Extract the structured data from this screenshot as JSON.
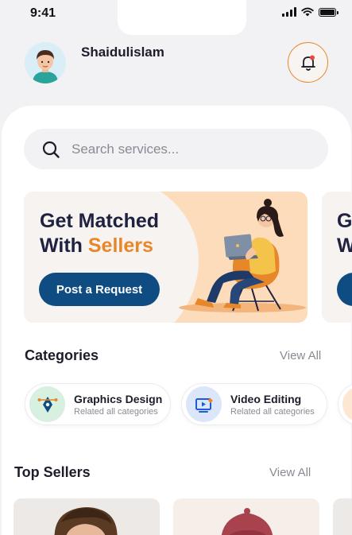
{
  "status_bar": {
    "time": "9:41"
  },
  "header": {
    "user_name": "Shaidulislam"
  },
  "search": {
    "placeholder": "Search services..."
  },
  "banner": {
    "title_line1": "Get Matched",
    "title_line2_prefix": "With ",
    "title_line2_accent": "Sellers",
    "button_label": "Post a Request",
    "next_title_line1": "G",
    "next_title_line2": "W"
  },
  "categories": {
    "title": "Categories",
    "view_all": "View All",
    "items": [
      {
        "name": "Graphics Design",
        "subtitle": "Related all categories",
        "icon": "pen-tool-icon"
      },
      {
        "name": "Video Editing",
        "subtitle": "Related all categories",
        "icon": "video-edit-icon"
      }
    ]
  },
  "top_sellers": {
    "title": "Top Sellers",
    "view_all": "View All"
  },
  "colors": {
    "accent": "#e8862a",
    "primary": "#0f4c81",
    "banner_bg": "#fcdcba",
    "heading": "#1e2140"
  }
}
